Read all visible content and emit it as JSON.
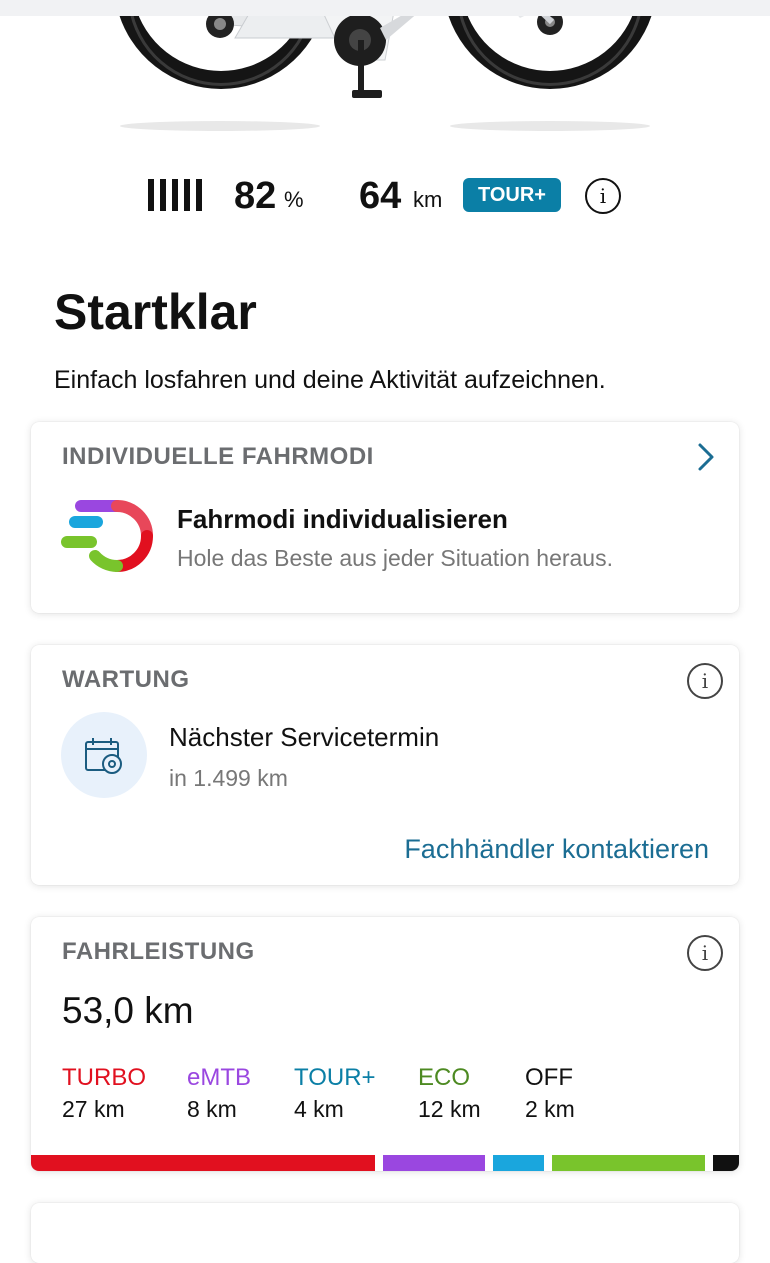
{
  "status": {
    "battery_percent": "82",
    "battery_unit": "%",
    "range_value": "64",
    "range_unit": "km",
    "mode_badge": "TOUR+",
    "info_glyph": "i"
  },
  "title": "Startklar",
  "subtitle": "Einfach losfahren und deine Aktivität aufzeichnen.",
  "riding_modes_card": {
    "header": "INDIVIDUELLE FAHRMODI",
    "title": "Fahrmodi individualisieren",
    "subtitle": "Hole das Beste aus jeder Situation heraus."
  },
  "maintenance_card": {
    "header": "WARTUNG",
    "title": "Nächster Servicetermin",
    "subtitle": "in 1.499 km",
    "link": "Fachhändler kontaktieren"
  },
  "mileage_card": {
    "header": "FAHRLEISTUNG",
    "total": "53,0 km",
    "modes": [
      {
        "name": "TURBO",
        "km_label": "27 km",
        "km": 27,
        "color": "#e1101f"
      },
      {
        "name": "eMTB",
        "km_label": "8 km",
        "km": 8,
        "color": "#9a47e0"
      },
      {
        "name": "TOUR+",
        "km_label": "4 km",
        "km": 4,
        "color": "#0b7fa6"
      },
      {
        "name": "ECO",
        "km_label": "12 km",
        "km": 12,
        "color": "#4d8a22"
      },
      {
        "name": "OFF",
        "km_label": "2 km",
        "km": 2,
        "color": "#111111"
      }
    ],
    "bar_colors": [
      "#e1101f",
      "#9a47e0",
      "#1aa6dd",
      "#79c42c",
      "#111111"
    ]
  },
  "colors": {
    "accent": "#0b7fa6",
    "link": "#1b6d93"
  }
}
